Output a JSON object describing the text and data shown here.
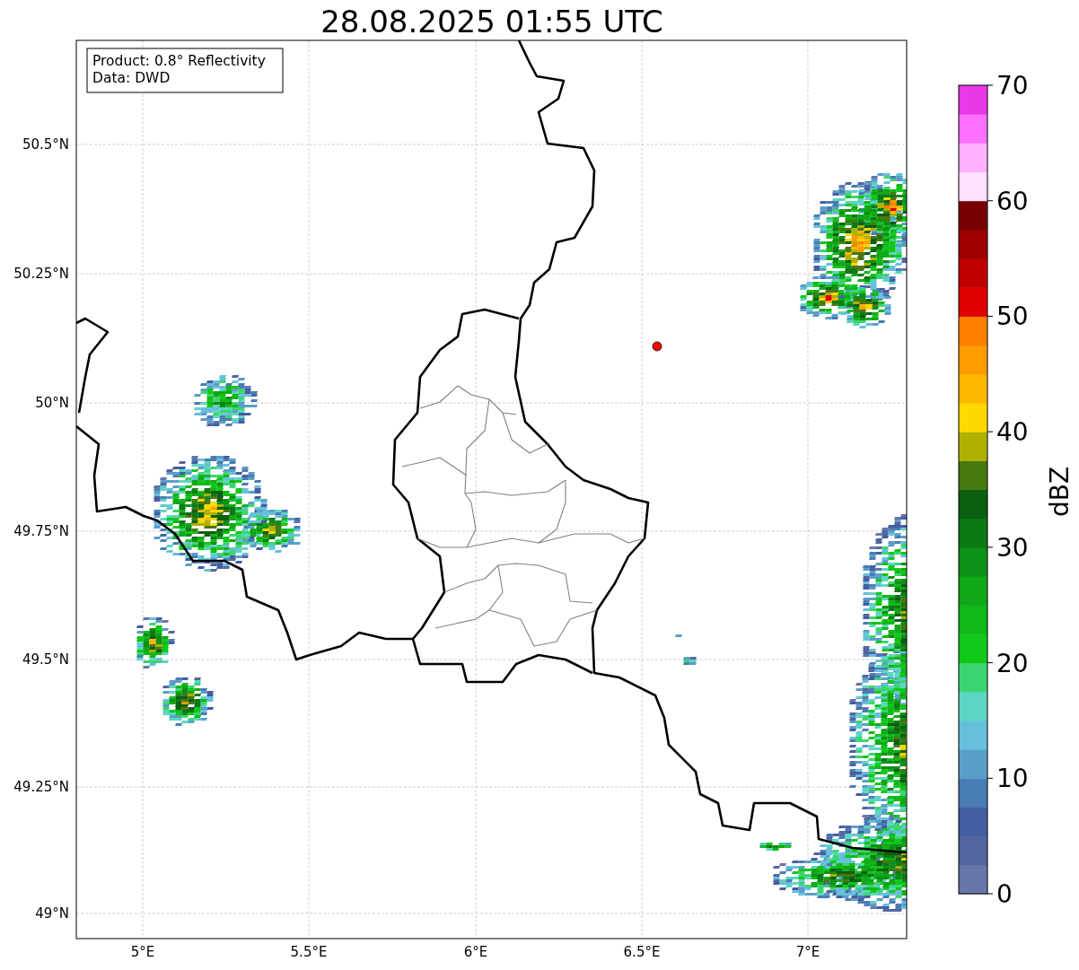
{
  "title": "28.08.2025 01:55 UTC",
  "info_box": [
    "Product: 0.8° Reflectivity",
    "Data: DWD"
  ],
  "x_axis": {
    "ticks": [
      "5°E",
      "5.5°E",
      "6°E",
      "6.5°E",
      "7°E"
    ]
  },
  "y_axis": {
    "ticks": [
      "50.5°N",
      "50.25°N",
      "50°N",
      "49.75°N",
      "49.5°N",
      "49.25°N",
      "49°N"
    ]
  },
  "colorbar": {
    "label": "dBZ",
    "ticks": [
      "70",
      "60",
      "50",
      "40",
      "30",
      "20",
      "10",
      "0"
    ],
    "bands": [
      {
        "color": "#6676a8"
      },
      {
        "color": "#5466a0"
      },
      {
        "color": "#445ea0"
      },
      {
        "color": "#4a7cb4"
      },
      {
        "color": "#5a9ec8"
      },
      {
        "color": "#66c0dc"
      },
      {
        "color": "#5cd6c2"
      },
      {
        "color": "#3cd470"
      },
      {
        "color": "#10c818"
      },
      {
        "color": "#10b818"
      },
      {
        "color": "#10a816"
      },
      {
        "color": "#0c9016"
      },
      {
        "color": "#0c7a14"
      },
      {
        "color": "#0a6010"
      },
      {
        "color": "#487810"
      },
      {
        "color": "#b0b000"
      },
      {
        "color": "#ffd800"
      },
      {
        "color": "#ffb800"
      },
      {
        "color": "#ff9c00"
      },
      {
        "color": "#ff8000"
      },
      {
        "color": "#e00000"
      },
      {
        "color": "#c00000"
      },
      {
        "color": "#a00000"
      },
      {
        "color": "#780000"
      },
      {
        "color": "#ffe0ff"
      },
      {
        "color": "#ffb0ff"
      },
      {
        "color": "#ff70ff"
      },
      {
        "color": "#e838e8"
      }
    ]
  }
}
